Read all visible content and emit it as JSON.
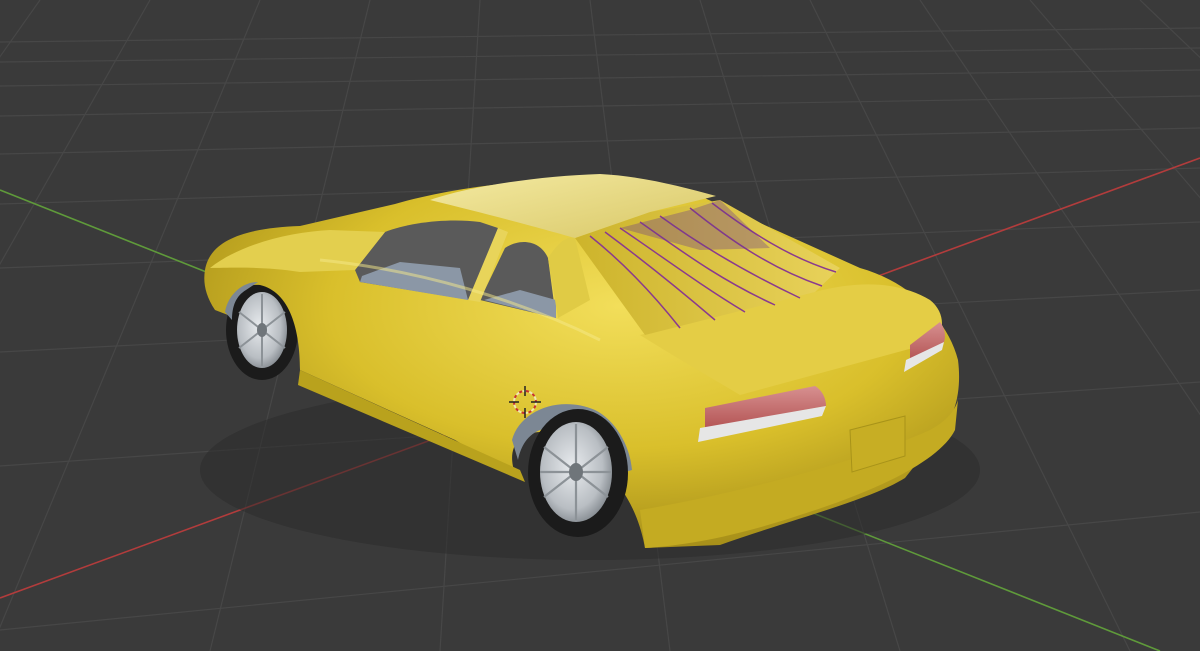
{
  "viewport": {
    "mode": "3d-viewport",
    "background_color": "#3a3a3a",
    "grid_color": "#4d4d4d",
    "x_axis_color": "#b23c3c",
    "y_axis_color": "#5f9a3a"
  },
  "scene": {
    "object": {
      "type": "car-model",
      "body_color": "#d9bf2b",
      "roof_color": "#e1d47a",
      "rear_window_color": "#6a3a8c",
      "tire_color": "#1b1b1b",
      "rim_color": "#bfc3c7",
      "taillight_color": "#c86767"
    },
    "origin_marker": {
      "icon": "3d-cursor-icon",
      "color": "#f0e7b2"
    }
  }
}
